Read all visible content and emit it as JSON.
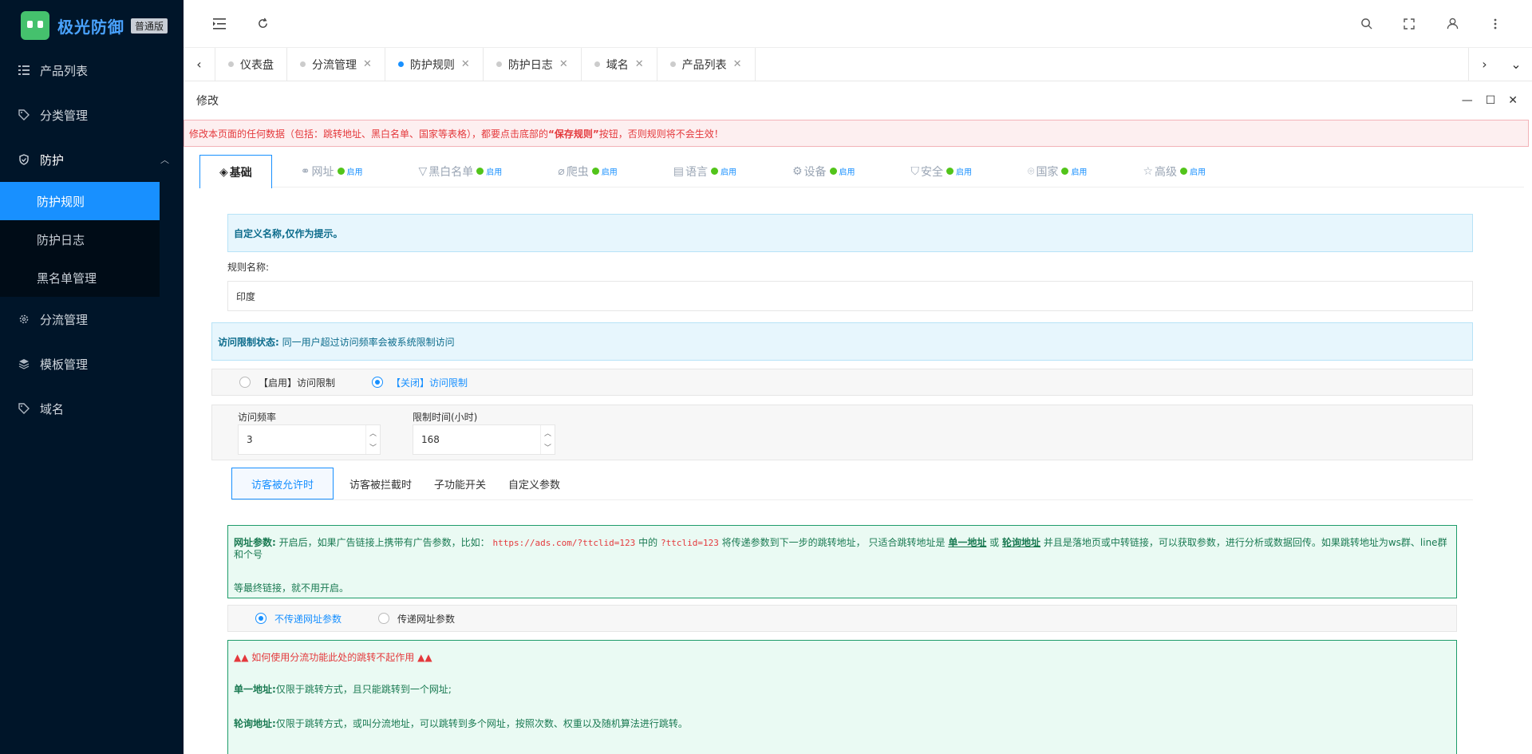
{
  "app": {
    "title": "极光防御",
    "edition": "普通版"
  },
  "sidebar": {
    "items": [
      {
        "label": "产品列表",
        "icon": "list-icon"
      },
      {
        "label": "分类管理",
        "icon": "tag-icon"
      },
      {
        "label": "防护",
        "icon": "shield-icon",
        "expanded": true,
        "children": [
          {
            "label": "防护规则",
            "active": true
          },
          {
            "label": "防护日志"
          },
          {
            "label": "黑名单管理"
          }
        ]
      },
      {
        "label": "分流管理",
        "icon": "gear-icon"
      },
      {
        "label": "模板管理",
        "icon": "layers-icon"
      },
      {
        "label": "域名",
        "icon": "tag-icon"
      }
    ]
  },
  "tabs": [
    {
      "label": "仪表盘",
      "closable": false
    },
    {
      "label": "分流管理",
      "closable": true
    },
    {
      "label": "防护规则",
      "closable": true,
      "active": true
    },
    {
      "label": "防护日志",
      "closable": true
    },
    {
      "label": "域名",
      "closable": true
    },
    {
      "label": "产品列表",
      "closable": true
    }
  ],
  "modal": {
    "title": "修改"
  },
  "warning": {
    "pre": "修改本页面的任何数据（包括：跳转地址、黑白名单、国家等表格），都要点击底部的",
    "highlight": "“保存规则”",
    "post": "按钮，否则规则将不会生效！"
  },
  "feature_tabs": [
    {
      "label": "基础",
      "icon": "layers-icon",
      "active": true
    },
    {
      "label": "网址",
      "icon": "link-icon",
      "status": "启用"
    },
    {
      "label": "黑白名单",
      "icon": "filter-icon",
      "status": "启用"
    },
    {
      "label": "爬虫",
      "icon": "bug-icon",
      "status": "启用"
    },
    {
      "label": "语言",
      "icon": "language-icon",
      "status": "启用"
    },
    {
      "label": "设备",
      "icon": "device-icon",
      "status": "启用"
    },
    {
      "label": "安全",
      "icon": "shield-icon",
      "status": "启用"
    },
    {
      "label": "国家",
      "icon": "location-icon",
      "status": "启用"
    },
    {
      "label": "高级",
      "icon": "star-icon",
      "status": "启用"
    }
  ],
  "basic": {
    "name_tip": "自定义名称,仅作为提示。",
    "name_label": "规则名称:",
    "name_value": "印度",
    "limit_title": "访问限制状态:",
    "limit_desc": "同一用户超过访问频率会被系统限制访问",
    "limit_on": "【启用】访问限制",
    "limit_off": "【关闭】访问限制",
    "limit_selected": "off",
    "freq_label": "访问频率",
    "freq_value": "3",
    "time_label": "限制时间(小时)",
    "time_value": "168"
  },
  "sub_tabs": [
    {
      "label": "访客被允许时",
      "active": true
    },
    {
      "label": "访客被拦截时"
    },
    {
      "label": "子功能开关"
    },
    {
      "label": "自定义参数"
    }
  ],
  "url_param": {
    "title": "网址参数:",
    "t1": "开启后，如果广告链接上携带有广告参数，比如：",
    "code1": "https://ads.com/?ttclid=123",
    "t2": "中的",
    "code2": "?ttclid=123",
    "t3": "将传递参数到下一步的跳转地址， 只适合跳转地址是",
    "link1": "单一地址",
    "t4": "或",
    "link2": "轮询地址",
    "t5": "并且是落地页或中转链接，可以获取参数，进行分析或数据回传。如果跳转地址为ws群、line群和个号",
    "t6": "等最终链接，就不用开启。",
    "opt_no": "不传递网址参数",
    "opt_yes": "传递网址参数"
  },
  "help": {
    "title": "如何使用分流功能此处的跳转不起作用",
    "single_label": "单一地址:",
    "single_desc": "仅限于跳转方式，且只能跳转到一个网址;",
    "poll_label": "轮询地址:",
    "poll_desc": "仅限于跳转方式，或叫分流地址，可以跳转到多个网址，按照次数、权重以及随机算法进行跳转。"
  },
  "colors": {
    "primary": "#1890ff",
    "sidebar": "#001529",
    "success": "#52c41a",
    "danger": "#e4393c"
  }
}
